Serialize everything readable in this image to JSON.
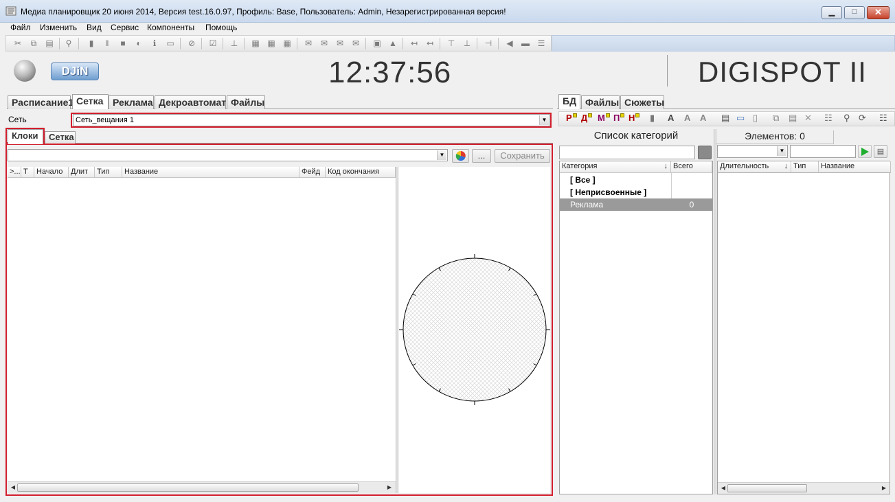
{
  "window": {
    "title": "Медиа планировщик 20 июня 2014, Версия test.16.0.97, Профиль: Base, Пользователь: Admin, Незарегистрированная версия!"
  },
  "menu": [
    "Файл",
    "Изменить",
    "Вид",
    "Сервис",
    "Компоненты",
    "Помощь"
  ],
  "header": {
    "logo_text": "DJiN",
    "clock": "12:37:56",
    "brand": "DIGISPOT II"
  },
  "left_tabs": [
    "Расписание1",
    "Сетка",
    "Реклама",
    "Декроавтомат",
    "Файлы"
  ],
  "left_active_tab": "Сетка",
  "network": {
    "label": "Сеть",
    "value": "Сеть_вещания 1"
  },
  "sub_tabs": [
    "Клоки",
    "Сетка"
  ],
  "sub_active_tab": "Клоки",
  "clock_panel": {
    "clock_select_value": "",
    "more_button": "...",
    "save_button": "Сохранить",
    "columns": [
      ">...",
      "Т",
      "Начало",
      "Длит",
      "Тип",
      "Название",
      "Фейд",
      "Код окончания"
    ]
  },
  "right_tabs": [
    "БД",
    "Файлы",
    "Сюжеты"
  ],
  "right_active_tab": "БД",
  "right_toolbar_letters": [
    "Р",
    "Д",
    "М",
    "П",
    "Н"
  ],
  "categories": {
    "title": "Список категорий",
    "search_value": "",
    "columns": [
      "Категория",
      "Всего"
    ],
    "rows": [
      {
        "name": "[ Все ]",
        "total": "",
        "bold": true,
        "selected": false
      },
      {
        "name": "[ Неприсвоенные ]",
        "total": "",
        "bold": true,
        "selected": false
      },
      {
        "name": "Реклама",
        "total": "0",
        "bold": false,
        "selected": true
      }
    ]
  },
  "elements": {
    "title": "Элементов: 0",
    "columns": [
      "Длительность",
      "Тип",
      "Название"
    ]
  },
  "colors": {
    "highlight_red": "#d21f2d",
    "selected_row": "#9a9a9a",
    "play_green": "#1fae2e"
  }
}
